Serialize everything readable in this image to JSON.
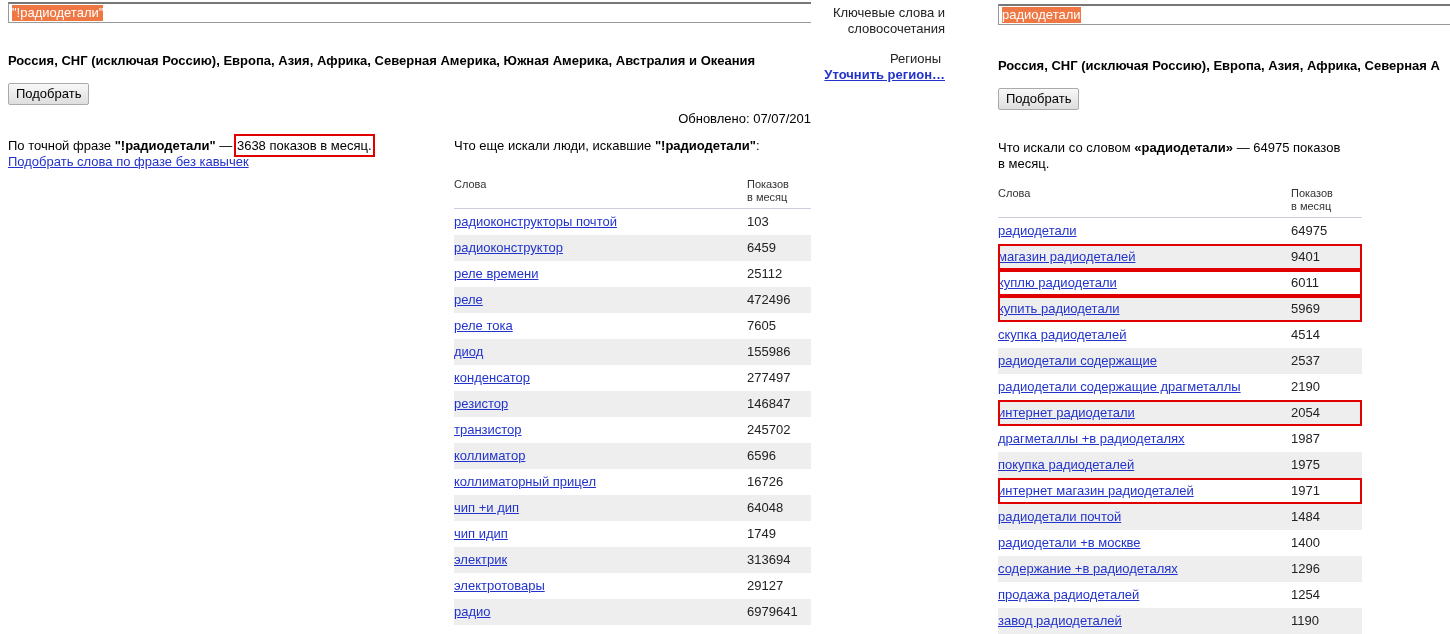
{
  "left_panel": {
    "query": {
      "value": "\"!радиодетали\"",
      "selected": true
    },
    "regions": "Россия, СНГ (исключая Россию), Европа, Азия, Африка, Северная Америка, Южная Америка, Австралия и Океания",
    "button": "Подобрать",
    "updated": "Обновлено: 07/07/201",
    "summary": {
      "text": "По точной фразе **\"!радиодетали\"** —",
      "count": "3638 показов в месяц.",
      "annotated": true
    },
    "link": "Подобрать слова по фразе без кавычек",
    "table_title": "Что еще искали люди, искавшие **\"!радиодетали\"**:",
    "columns": [
      "Слова",
      "Показов в месяц"
    ],
    "rows": [
      {
        "phrase": "радиоконструкторы почтой",
        "count": "103",
        "annotated": false
      },
      {
        "phrase": "радиоконструктор",
        "count": "6459",
        "annotated": false
      },
      {
        "phrase": "реле времени",
        "count": "25112",
        "annotated": false
      },
      {
        "phrase": "реле",
        "count": "472496",
        "annotated": false
      },
      {
        "phrase": "реле тока",
        "count": "7605",
        "annotated": false
      },
      {
        "phrase": "диод",
        "count": "155986",
        "annotated": false
      },
      {
        "phrase": "конденсатор",
        "count": "277497",
        "annotated": false
      },
      {
        "phrase": "резистор",
        "count": "146847",
        "annotated": false
      },
      {
        "phrase": "транзистор",
        "count": "245702",
        "annotated": false
      },
      {
        "phrase": "коллиматор",
        "count": "6596",
        "annotated": false
      },
      {
        "phrase": "коллиматорный прицел",
        "count": "16726",
        "annotated": false
      },
      {
        "phrase": "чип +и дип",
        "count": "64048",
        "annotated": false
      },
      {
        "phrase": "чип идип",
        "count": "1749",
        "annotated": false
      },
      {
        "phrase": "электрик",
        "count": "313694",
        "annotated": false
      },
      {
        "phrase": "электротовары",
        "count": "29127",
        "annotated": false
      },
      {
        "phrase": "радио",
        "count": "6979641",
        "annotated": false
      }
    ]
  },
  "right_panel": {
    "keywords_label": "Ключевые слова и словосочетания",
    "regions_label": "Регионы",
    "regions_link": "Уточнить регион…",
    "query": {
      "value": "радиодетали",
      "selected": true
    },
    "regions": "Россия, СНГ (исключая Россию), Европа, Азия, Африка, Северная А",
    "button": "Подобрать",
    "summary": "Что искали со словом **«радиодетали»** — 64975 показов в месяц.",
    "columns": [
      "Слова",
      "Показов в месяц"
    ],
    "rows": [
      {
        "phrase": "радиодетали",
        "count": "64975",
        "annotated": false
      },
      {
        "phrase": "магазин радиодеталей",
        "count": "9401",
        "annotated": true
      },
      {
        "phrase": "куплю радиодетали",
        "count": "6011",
        "annotated": true
      },
      {
        "phrase": "купить радиодетали",
        "count": "5969",
        "annotated": true
      },
      {
        "phrase": "скупка радиодеталей",
        "count": "4514",
        "annotated": false
      },
      {
        "phrase": "радиодетали содержащие",
        "count": "2537",
        "annotated": false
      },
      {
        "phrase": "радиодетали содержащие драгметаллы",
        "count": "2190",
        "annotated": false
      },
      {
        "phrase": "интернет радиодетали",
        "count": "2054",
        "annotated": true
      },
      {
        "phrase": "драгметаллы +в радиодеталях",
        "count": "1987",
        "annotated": false
      },
      {
        "phrase": "покупка радиодеталей",
        "count": "1975",
        "annotated": false
      },
      {
        "phrase": "интернет магазин радиодеталей",
        "count": "1971",
        "annotated": true
      },
      {
        "phrase": "радиодетали почтой",
        "count": "1484",
        "annotated": false
      },
      {
        "phrase": "радиодетали +в москве",
        "count": "1400",
        "annotated": false
      },
      {
        "phrase": "содержание +в радиодеталях",
        "count": "1296",
        "annotated": false
      },
      {
        "phrase": "продажа радиодеталей",
        "count": "1254",
        "annotated": false
      },
      {
        "phrase": "завод радиодеталей",
        "count": "1190",
        "annotated": false
      }
    ]
  }
}
